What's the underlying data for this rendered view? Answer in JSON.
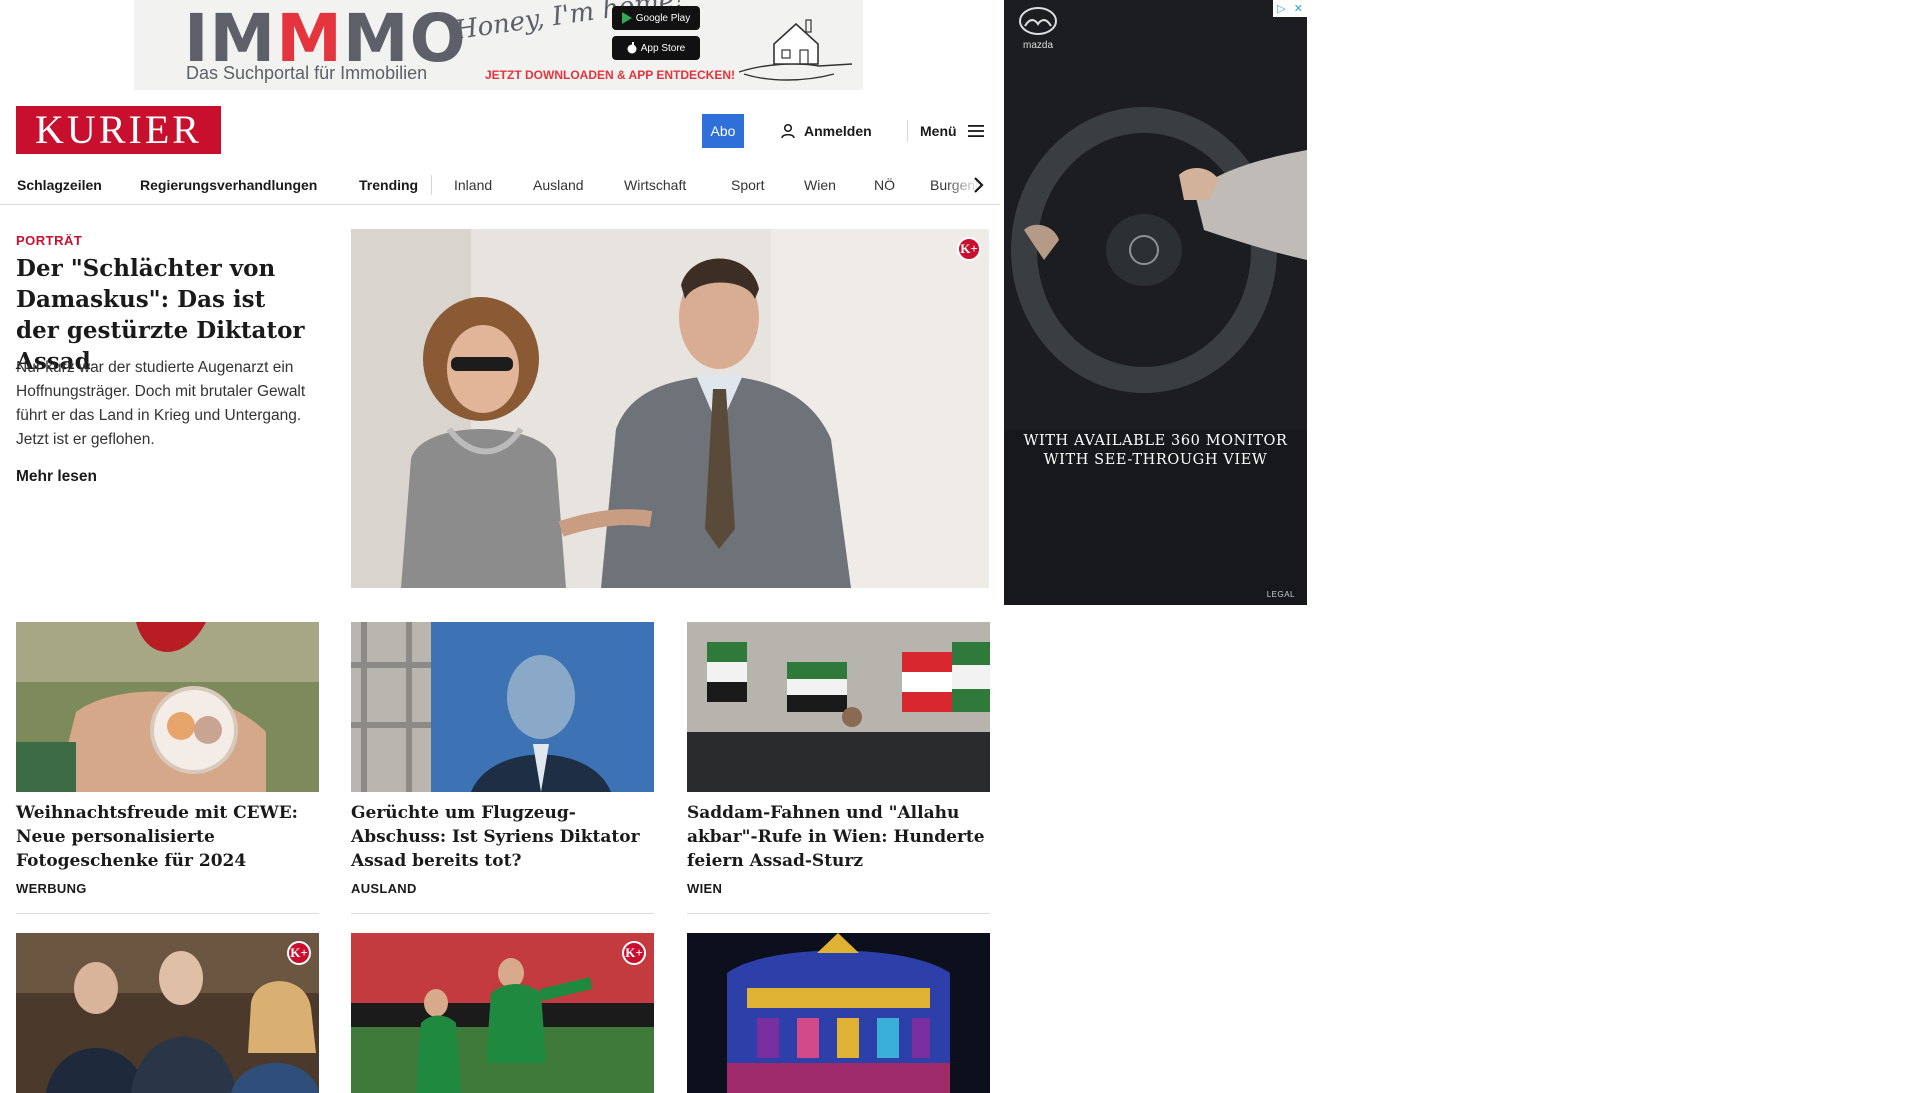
{
  "top_ad": {
    "brand_pre": "IM",
    "brand_red": "M",
    "brand_post": "MO",
    "tagline": "Das Suchportal für Immobilien",
    "script_text": "Honey, I'm home!",
    "google_play": "Google Play",
    "app_store": "App Store",
    "cta": "JETZT DOWNLOADEN & APP ENTDECKEN!"
  },
  "header": {
    "logo": "KURIER",
    "abo": "Abo",
    "login": "Anmelden",
    "menu": "Menü"
  },
  "nav": {
    "items": [
      "Schlagzeilen",
      "Regierungsverhandlungen",
      "Trending",
      "Inland",
      "Ausland",
      "Wirtschaft",
      "Sport",
      "Wien",
      "NÖ",
      "Burgenl"
    ]
  },
  "lead": {
    "kicker": "PORTRÄT",
    "title": "Der \"Schlächter von Damaskus\": Das ist der gestürzte Diktator Assad",
    "teaser": "Nur kurz war der studierte Augenarzt ein Hoffnungsträger. Doch mit brutaler Gewalt führt er das Land in Krieg und Untergang. Jetzt ist er geflohen.",
    "more": "Mehr lesen",
    "badge": "K+"
  },
  "side_ad": {
    "brand": "mazda",
    "text": "WITH AVAILABLE 360 MONITOR WITH SEE-THROUGH VIEW",
    "legal": "LEGAL",
    "adchoice_play": "▷",
    "adchoice_close": "✕"
  },
  "cards_row1": [
    {
      "title": "Weihnachtsfreude mit CEWE: Neue personalisierte Fotogeschenke für 2024",
      "label": "WERBUNG"
    },
    {
      "title": "Gerüchte um Flugzeug-Abschuss: Ist Syriens Diktator Assad bereits tot?",
      "label": "AUSLAND"
    },
    {
      "title": "Saddam-Fahnen und \"Allahu akbar\"-Rufe in Wien: Hunderte feiern Assad-Sturz",
      "label": "WIEN"
    }
  ],
  "cards_row2_badges": [
    "K+",
    "K+"
  ],
  "colors": {
    "brand_red": "#c8102e",
    "abo_blue": "#2f6fd9"
  }
}
